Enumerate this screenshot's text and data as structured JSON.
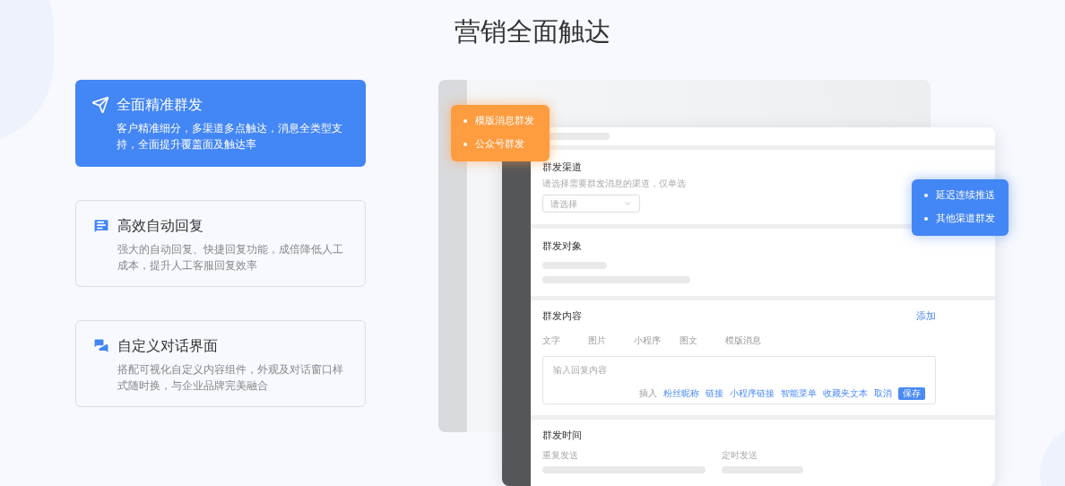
{
  "title": "营销全面触达",
  "features": [
    {
      "title": "全面精准群发",
      "description": "客户精准细分，多渠道多点触达，消息全类型支持，全面提升覆盖面及触达率",
      "selected": true
    },
    {
      "title": "高效自动回复",
      "description": "强大的自动回复、快捷回复功能，成倍降低人工成本，提升人工客服回复效率",
      "selected": false
    },
    {
      "title": "自定义对话界面",
      "description": "搭配可视化自定义内容组件，外观及对话窗口样式随时换，与企业品牌完美融合",
      "selected": false
    }
  ],
  "mockup": {
    "orange_popup": [
      "模版消息群发",
      "公众号群发"
    ],
    "blue_popup": [
      "延迟连续推送",
      "其他渠道群发"
    ],
    "sections": [
      {
        "kind": "select",
        "title": "群发渠道",
        "hint": "请选择需要群发消息的渠道，仅单选",
        "placeholder": "请选择"
      },
      {
        "kind": "skeleton",
        "title": "群发对象"
      },
      {
        "kind": "editor",
        "title": "群发内容",
        "action": "添加",
        "tabs": [
          "文字",
          "图片",
          "小程序",
          "图文",
          "模版消息"
        ],
        "placeholder": "输入回复内容",
        "insert_label": "插入",
        "insert_links": [
          "粉丝昵称",
          "链接",
          "小程序链接",
          "智能菜单",
          "收藏夹文本",
          "取消"
        ],
        "save": "保存"
      },
      {
        "kind": "schedule",
        "title": "群发时间",
        "fields": [
          "重复发送",
          "定时发送"
        ]
      }
    ]
  }
}
